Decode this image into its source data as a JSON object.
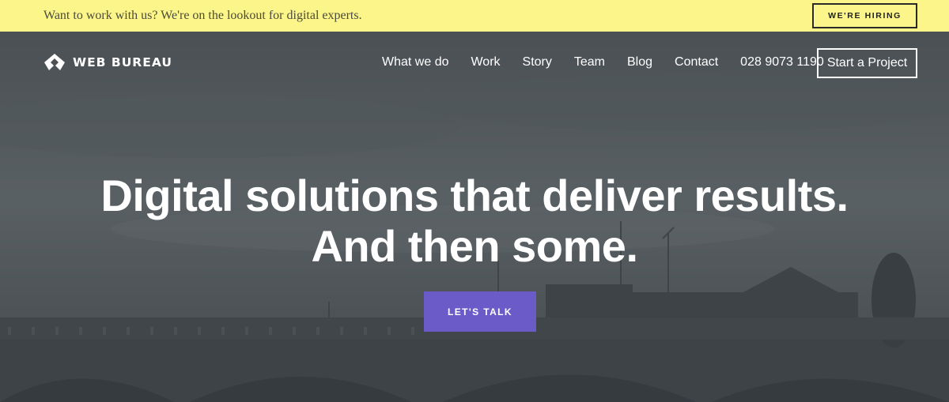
{
  "banner": {
    "text": "Want to work with us? We're on the lookout for digital experts.",
    "button_label": "WE'RE HIRING",
    "background": "#fbf58a"
  },
  "header": {
    "logo_text": "WEB BUREAU",
    "logo_icon": "web-bureau-logo-icon",
    "nav": [
      {
        "label": "What we do"
      },
      {
        "label": "Work"
      },
      {
        "label": "Story"
      },
      {
        "label": "Team"
      },
      {
        "label": "Blog"
      },
      {
        "label": "Contact"
      }
    ],
    "phone": "028 9073 1190",
    "project_button_label": "Start a Project"
  },
  "hero": {
    "headline_line1": "Digital solutions that deliver results.",
    "headline_line2": "And then some.",
    "cta_label": "LET'S TALK",
    "cta_color": "#6b5bc9"
  }
}
